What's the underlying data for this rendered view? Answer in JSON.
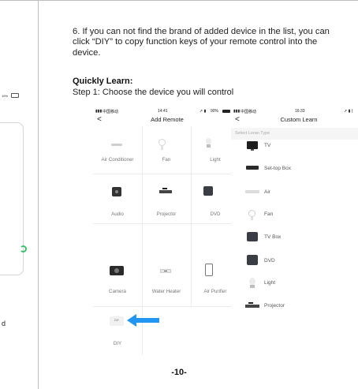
{
  "instruction": {
    "paragraph": "6. If you can not find the brand of added device in the list, you can click “DIY” to copy function keys of your remote control into the device.",
    "heading": "Quickly Learn:",
    "step": "Step 1:  Choose the device you will control"
  },
  "left_fragment": {
    "battery": "19%",
    "partial_text": "d"
  },
  "phone_add_remote": {
    "status": {
      "carrier": "中国移动",
      "time": "14:41",
      "battery": "90%"
    },
    "back": "<",
    "title": "Add Remote",
    "tiles": [
      {
        "label": "Air Conditioner",
        "icon": "air-conditioner-icon"
      },
      {
        "label": "Fan",
        "icon": "fan-icon"
      },
      {
        "label": "Light",
        "icon": "light-bulb-icon"
      },
      {
        "label": "Audio",
        "icon": "audio-icon"
      },
      {
        "label": "Projector",
        "icon": "projector-icon"
      },
      {
        "label": "DVD",
        "icon": "dvd-icon"
      },
      {
        "label": "Camera",
        "icon": "camera-icon"
      },
      {
        "label": "Water Heater",
        "icon": "water-heater-icon"
      },
      {
        "label": "Air Purifier",
        "icon": "air-purifier-icon"
      },
      {
        "label": "DIY",
        "icon": "diy-icon"
      }
    ],
    "diy_badge": "DIY",
    "arrow_color": "#2196f3"
  },
  "phone_custom_learn": {
    "status": {
      "carrier": "中国移动",
      "time": "16:33"
    },
    "back": "<",
    "title": "Custom Learn",
    "hint": "Select Leran Type",
    "items": [
      {
        "label": "TV",
        "icon": "tv-icon"
      },
      {
        "label": "Set-top Box",
        "icon": "set-top-box-icon"
      },
      {
        "label": "Air",
        "icon": "air-conditioner-icon"
      },
      {
        "label": "Fan",
        "icon": "fan-icon"
      },
      {
        "label": "TV Box",
        "icon": "tv-box-icon"
      },
      {
        "label": "DVD",
        "icon": "dvd-icon"
      },
      {
        "label": "Light",
        "icon": "light-bulb-icon"
      },
      {
        "label": "Projector",
        "icon": "projector-icon"
      }
    ]
  },
  "page_number": "-10-"
}
